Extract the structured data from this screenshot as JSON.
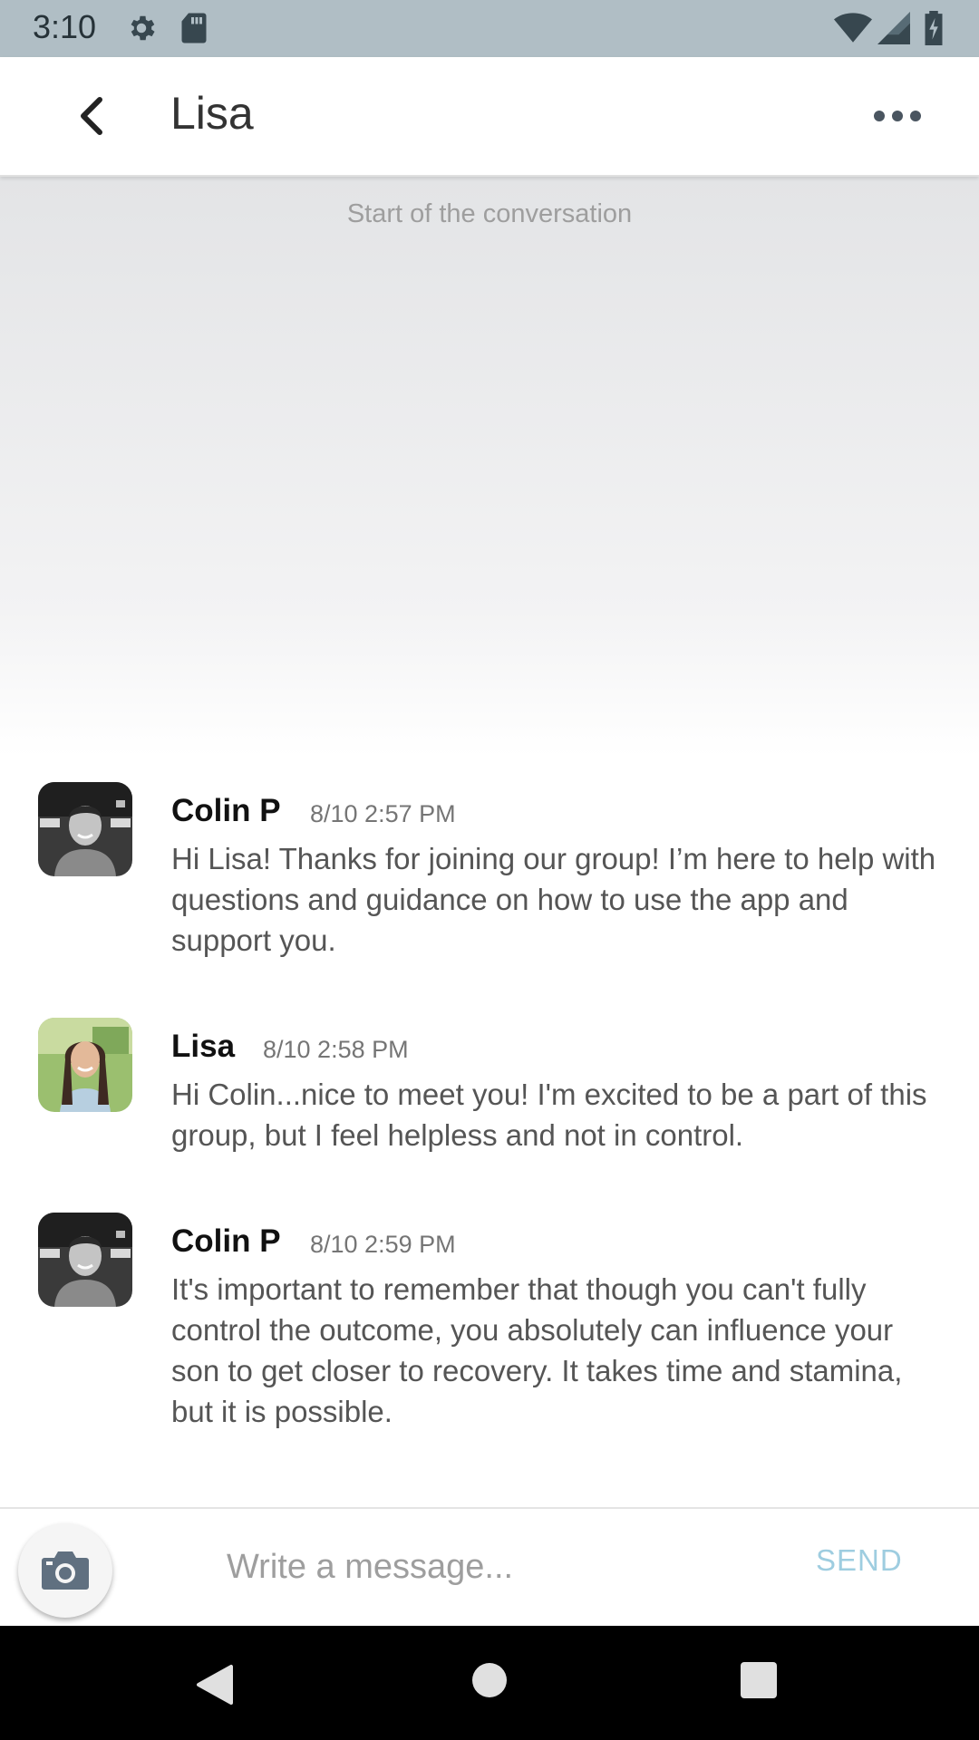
{
  "status_bar": {
    "time": "3:10",
    "icons": [
      "gear-icon",
      "sd-card-icon",
      "wifi-icon",
      "signal-icon",
      "battery-icon"
    ]
  },
  "header": {
    "title": "Lisa",
    "back_icon": "chevron-left-icon",
    "menu_icon": "more-horizontal-icon"
  },
  "conversation": {
    "start_label": "Start of the conversation",
    "messages": [
      {
        "sender": "Colin P",
        "timestamp": "8/10 2:57 PM",
        "text": "Hi Lisa! Thanks for joining our group! I’m here to help with questions and guidance on how to use the app and support you."
      },
      {
        "sender": "Lisa",
        "timestamp": "8/10 2:58 PM",
        "text": "Hi Colin...nice to meet you! I'm excited to be a part of this group, but I feel helpless and not in control."
      },
      {
        "sender": "Colin P",
        "timestamp": "8/10 2:59 PM",
        "text": "It's important to remember that though you can't fully control the outcome, you absolutely can influence your son to get closer to recovery. It takes time and stamina, but it is possible."
      }
    ]
  },
  "composer": {
    "placeholder": "Write a message...",
    "value": "",
    "send_label": "SEND",
    "camera_icon": "camera-icon"
  },
  "nav_bar": {
    "icons": [
      "back-triangle-icon",
      "home-circle-icon",
      "recents-square-icon"
    ]
  },
  "colors": {
    "status_bar": "#b0bec5",
    "send_accent": "#9ecde0",
    "nav_bar": "#000000"
  }
}
